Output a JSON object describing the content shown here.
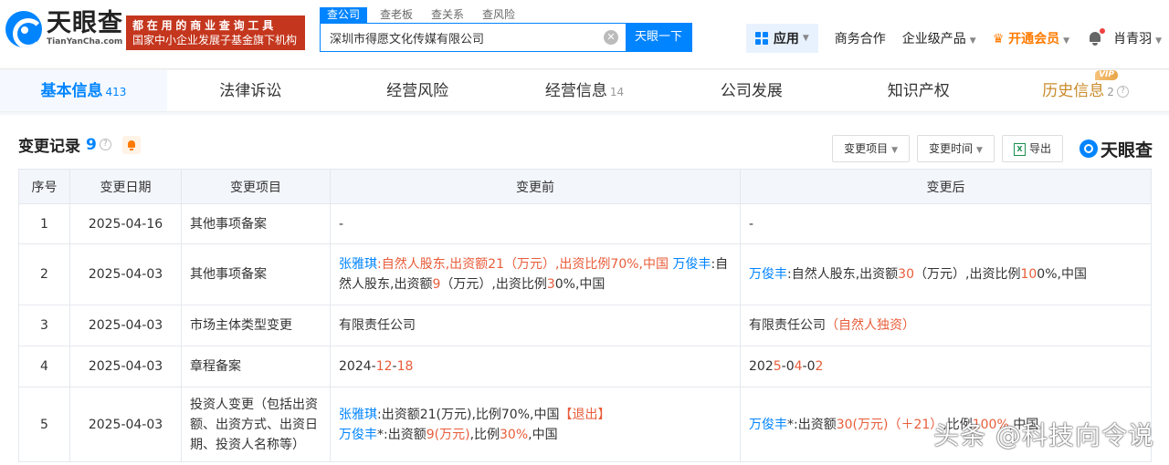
{
  "header": {
    "logo_cn": "天眼查",
    "logo_en": "TianYanCha.com",
    "slogan_line1": "都在用的商业查询工具",
    "slogan_line2": "国家中小企业发展子基金旗下机构",
    "search_tabs": [
      "查公司",
      "查老板",
      "查关系",
      "查风险"
    ],
    "search_value": "深圳市得愿文化传媒有限公司",
    "search_button": "天眼一下",
    "nav": {
      "app": "应用",
      "business": "商务合作",
      "enterprise": "企业级产品",
      "vip": "开通会员",
      "user": "肖青羽"
    }
  },
  "tabs": [
    {
      "label": "基本信息",
      "count": "413"
    },
    {
      "label": "法律诉讼",
      "count": ""
    },
    {
      "label": "经营风险",
      "count": ""
    },
    {
      "label": "经营信息",
      "count": "14"
    },
    {
      "label": "公司发展",
      "count": ""
    },
    {
      "label": "知识产权",
      "count": ""
    },
    {
      "label": "历史信息",
      "count": "2",
      "badge": "VIP"
    }
  ],
  "panel": {
    "title": "变更记录",
    "count": "9",
    "filter_item": "变更项目",
    "filter_time": "变更时间",
    "export": "导出",
    "brand": "天眼查"
  },
  "table": {
    "headers": [
      "序号",
      "变更日期",
      "变更项目",
      "变更前",
      "变更后"
    ],
    "rows": [
      {
        "no": "1",
        "date": "2025-04-16",
        "item": "其他事项备案",
        "before": "-",
        "after": "-"
      },
      {
        "no": "2",
        "date": "2025-04-03",
        "item": "其他事项备案",
        "before_name1": "张雅琪",
        "before_detail1": ":自然人股东,出资额21（万元）,出资比例70%,中国",
        "before_name2": "万俊丰",
        "before_detail2a": ":自然人股东,出资额",
        "before_v1": "9",
        "before_detail2b": "（万元）,出资比例",
        "before_v2": "3",
        "before_detail2c": "0%,中国",
        "after_name": "万俊丰",
        "after_d1": ":自然人股东,出资额",
        "after_v1": "30",
        "after_d2": "（万元）,出资比例",
        "after_v2": "10",
        "after_d3": "0%,中国"
      },
      {
        "no": "3",
        "date": "2025-04-03",
        "item": "市场主体类型变更",
        "before": "有限责任公司",
        "after_main": "有限责任公司",
        "after_extra": "（自然人独资）"
      },
      {
        "no": "4",
        "date": "2025-04-03",
        "item": "章程备案",
        "before_a": "2024-",
        "before_b": "12",
        "before_c": "-",
        "before_d": "18",
        "after_a": "202",
        "after_b": "5",
        "after_c": "-0",
        "after_d": "4",
        "after_e": "-0",
        "after_f": "2"
      },
      {
        "no": "5",
        "date": "2025-04-03",
        "item": "投资人变更（包括出资额、出资方式、出资日期、投资人名称等）",
        "before_name1": "张雅琪",
        "before_d1": ":出资额21(万元),比例70%,中国",
        "before_exit": "【退出】",
        "before_name2": "万俊丰",
        "before_d2": "*:出资额",
        "before_v1": "9(万元)",
        "before_d3": ",比例",
        "before_v2": "30%",
        "before_d4": ",中国",
        "after_name": "万俊丰",
        "after_d1": "*:出资额",
        "after_v1": "30(万元)（＋21）",
        "after_d2": ",比例",
        "after_v2": "100%",
        "after_d3": ",中国"
      }
    ]
  },
  "watermark": "头条 @科技向令说"
}
